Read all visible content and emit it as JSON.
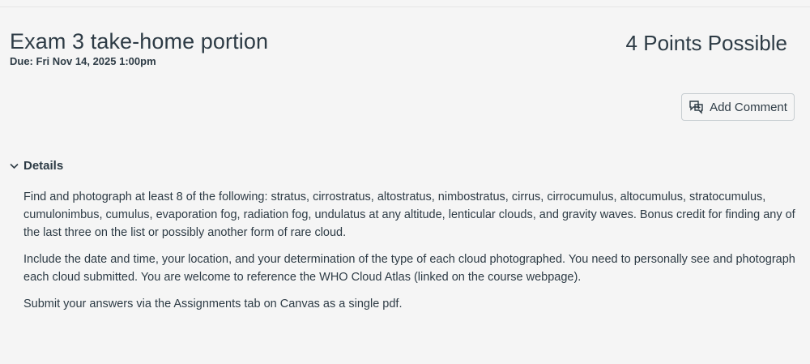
{
  "assignment": {
    "title": "Exam 3 take-home portion",
    "due": "Due: Fri Nov 14, 2025 1:00pm",
    "points": "4 Points Possible"
  },
  "actions": {
    "add_comment_label": "Add Comment",
    "add_comment_icon": "comment-add-icon"
  },
  "details": {
    "toggle_label": "Details",
    "toggle_icon": "chevron-down-icon",
    "paragraphs": [
      "Find and photograph at least 8 of the following: stratus, cirrostratus, altostratus, nimbostratus, cirrus, cirrocumulus, altocumulus, stratocumulus, cumulonimbus, cumulus, evaporation fog, radiation fog, undulatus at any altitude, lenticular clouds, and gravity waves. Bonus credit for finding any of the last three on the list or possibly another form of rare cloud.",
      "Include the date and time, your location, and your determination of the type of each cloud photographed. You need to personally see and photograph each cloud submitted. You are welcome to reference the WHO Cloud Atlas (linked on the course webpage).",
      "Submit your answers via the Assignments tab on Canvas as a single pdf."
    ]
  },
  "colors": {
    "text": "#2d3b45",
    "background": "#f5f5f5",
    "button_border": "#c7cdd1"
  }
}
